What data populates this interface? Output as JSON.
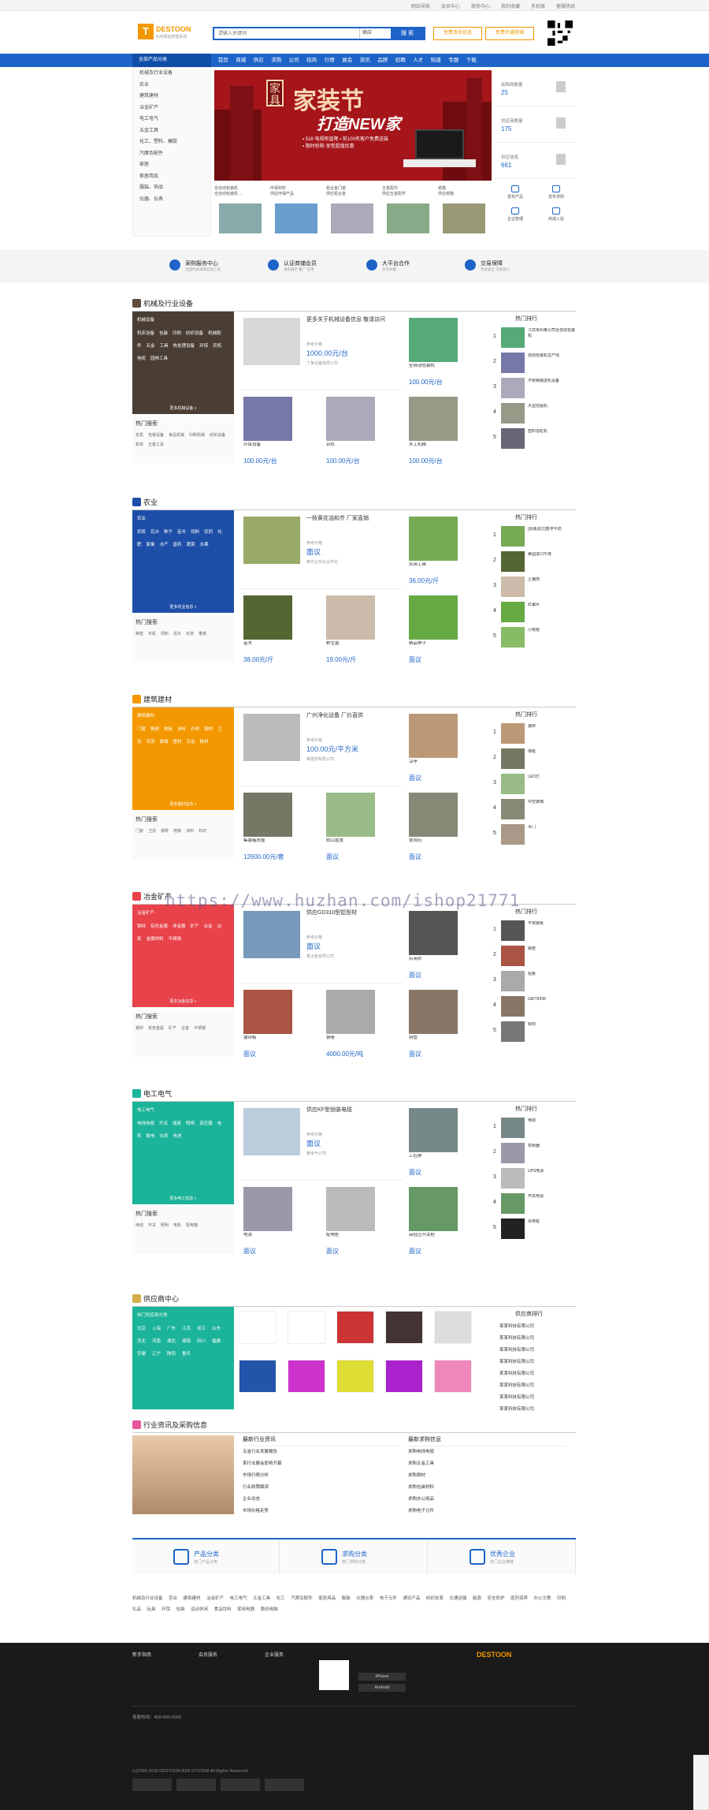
{
  "topbar": {
    "links": [
      "网站导航",
      "会员中心",
      "商务中心",
      "我的收藏",
      "手机版",
      "客服热线"
    ]
  },
  "logo": {
    "name": "DESTOON",
    "sub": "B2B网站管理系统"
  },
  "search": {
    "placeholder": "请输入关键词",
    "select": "供应",
    "button": "搜 索"
  },
  "header": {
    "btn1": "免费发布信息",
    "btn2": "免费开通商铺"
  },
  "nav": {
    "cat": "全部产品分类",
    "items": [
      "首页",
      "商城",
      "供应",
      "求购",
      "公司",
      "招商",
      "行情",
      "展会",
      "资讯",
      "品牌",
      "招聘",
      "人才",
      "知道",
      "专题",
      "下载"
    ]
  },
  "sidecat": [
    "机械及行业设备",
    "农业",
    "建筑建材",
    "冶金矿产",
    "电工电气",
    "五金工具",
    "化工、塑料、橡胶",
    "汽摩及配件",
    "家居",
    "家居用品",
    "服装、饰品",
    "仪器、仪表"
  ],
  "banner": {
    "kanji": "家 具",
    "t1": "家装节",
    "t2": "打造NEW家",
    "sub": "▪ 518 电视柜直降 ▪ 前100名客户免费送装",
    "sub2": "▪ 限时抢购 享受超值优惠"
  },
  "features": [
    {
      "title": "全自动包装机",
      "desc": "全自动包装机 ..."
    },
    {
      "title": "环保材料",
      "desc": "供应环保产品"
    },
    {
      "title": "铝合金门窗",
      "desc": "供应铝合金"
    },
    {
      "title": "五金配件",
      "desc": "供应五金配件"
    },
    {
      "title": "纸箱",
      "desc": "供应纸箱"
    }
  ],
  "stats": [
    {
      "label": "采购商数量",
      "num": "25"
    },
    {
      "label": "供应商数量",
      "num": "175"
    },
    {
      "label": "供应信息",
      "num": "661"
    }
  ],
  "tools": [
    "发布产品",
    "发布求购",
    "企业管理",
    "商城入驻"
  ],
  "services": [
    {
      "t": "采购服务中心",
      "d": "全国优质采购信息汇总"
    },
    {
      "t": "认证商铺会员",
      "d": "发布展示 推广 信用"
    },
    {
      "t": "大平台合作",
      "d": "合作共赢"
    },
    {
      "t": "交易保障",
      "d": "资金安全 交易放心"
    }
  ],
  "sections": [
    {
      "title": "机械及行业设备",
      "color": "#5e4c3e",
      "left": "#4a3e34",
      "ph": "机械设备",
      "links": [
        "机床设备",
        "包装",
        "印刷",
        "纺织设备",
        "机械配件",
        "五金",
        "工具",
        "热处理设备",
        "环保",
        "农机",
        "电机",
        "园林工具"
      ],
      "more": "更多机械设备 »",
      "hot": [
        "农机",
        "包装设备",
        "食品机械",
        "印刷机械",
        "纺织设备",
        "机床",
        "五金工具"
      ],
      "big": {
        "t": "更多关于机械设备信息 敬请访问",
        "lb": "参考价格",
        "pr": "1000.00元/台",
        "cp": "丁某设备有限公司"
      },
      "prods": [
        {
          "t": "全自动包装机",
          "pr": "100.00元/台"
        },
        {
          "t": "环保设备",
          "pr": "100.00元/台"
        },
        {
          "t": "农机",
          "pr": "100.00元/台"
        },
        {
          "t": "木工机械",
          "pr": "100.00元/台"
        },
        {
          "t": "电机",
          "pr": "100.00元/台"
        }
      ],
      "rank": [
        "江苏常州某公司全自动包装机",
        "自动包装机生产线",
        "不锈钢输送机设备",
        "大型挖掘机",
        "塑料造粒机"
      ]
    },
    {
      "title": "农业",
      "color": "#1e4fa8",
      "left": "#1e4fa8",
      "ph": "农业",
      "links": [
        "农机",
        "花卉",
        "种子",
        "苗木",
        "饲料",
        "农药",
        "化肥",
        "家禽",
        "水产",
        "兽药",
        "蔬菜",
        "水果"
      ],
      "more": "更多农业信息 »",
      "hot": [
        "种苗",
        "农机",
        "饲料",
        "花卉",
        "农资",
        "畜禽"
      ],
      "big": {
        "t": "一枝黄花油和芥 厂家直销",
        "lb": "参考价格",
        "pr": "面议",
        "cp": "某农业专业合作社"
      },
      "prods": [
        {
          "t": "农用工具",
          "pr": "36.00元/斤"
        },
        {
          "t": "苗木",
          "pr": "38.00元/斤"
        },
        {
          "t": "野生菌",
          "pr": "19.00元/斤"
        },
        {
          "t": "精品种子",
          "pr": "面议"
        },
        {
          "t": "茶树",
          "pr": "面议"
        }
      ],
      "rank": [
        "[原装进口]香芋牛奶",
        "美国进口牛排",
        "土猪肉",
        "红薯片",
        "小核桃"
      ]
    },
    {
      "title": "建筑建材",
      "color": "#f39800",
      "left": "#f39800",
      "ph": "建筑建材",
      "links": [
        "门窗",
        "陶瓷",
        "地板",
        "涂料",
        "石材",
        "钢材",
        "卫浴",
        "吊顶",
        "玻璃",
        "管材",
        "五金",
        "板材"
      ],
      "more": "更多建材信息 »",
      "hot": [
        "门窗",
        "卫浴",
        "瓷砖",
        "地板",
        "涂料",
        "石材"
      ],
      "big": {
        "t": "广州净化设备 厂价直供",
        "lb": "参考价格",
        "pr": "100.00元/平方米",
        "cp": "某建材有限公司"
      },
      "prods": [
        {
          "t": "凉亭",
          "pr": "面议"
        },
        {
          "t": "集装箱房屋",
          "pr": "12600.00元/套"
        },
        {
          "t": "假山盆景",
          "pr": "面议"
        },
        {
          "t": "景观石",
          "pr": "面议"
        },
        {
          "t": "木屋",
          "pr": "面议"
        }
      ],
      "rank": [
        "瓷砖",
        "墙纸",
        "LED灯",
        "中空玻璃",
        "木门"
      ]
    },
    {
      "title": "冶金矿产",
      "color": "#e8424a",
      "left": "#e8424a",
      "ph": "冶金矿产",
      "links": [
        "钢材",
        "有色金属",
        "非金属",
        "矿产",
        "合金",
        "冶炼",
        "金属材料",
        "不锈钢"
      ],
      "more": "更多冶金信息 »",
      "hot": [
        "钢材",
        "有色金属",
        "矿产",
        "合金",
        "不锈钢"
      ],
      "big": {
        "t": "供应GD310型铝型材",
        "lb": "参考价格",
        "pr": "面议",
        "cp": "某冶金有限公司"
      },
      "prods": [
        {
          "t": "石英砂",
          "pr": "面议"
        },
        {
          "t": "镀锌板",
          "pr": "面议"
        },
        {
          "t": "钢卷",
          "pr": "4000.00元/吨"
        },
        {
          "t": "铜管",
          "pr": "面议"
        },
        {
          "t": "钢材",
          "pr": "面议"
        }
      ],
      "rank": [
        "不锈钢板",
        "钢管",
        "铝板",
        "GB/T9438",
        "铜材"
      ]
    },
    {
      "title": "电工电气",
      "color": "#1bb399",
      "left": "#1bb399",
      "ph": "电工电气",
      "links": [
        "电线电缆",
        "开关",
        "插座",
        "照明",
        "变压器",
        "电机",
        "配电",
        "仪表",
        "电池"
      ],
      "more": "更多电工信息 »",
      "hot": [
        "电线",
        "开关",
        "照明",
        "电机",
        "配电箱"
      ],
      "big": {
        "t": "供应KF型铠装电缆",
        "lb": "参考价格",
        "pr": "面议",
        "cp": "某电气公司"
      },
      "prods": [
        {
          "t": "工控屏",
          "pr": "面议"
        },
        {
          "t": "电源",
          "pr": "面议"
        },
        {
          "t": "配电柜",
          "pr": "面议"
        },
        {
          "t": "高低压开关柜",
          "pr": "面议"
        },
        {
          "t": "箱变",
          "pr": "面议"
        }
      ],
      "rank": [
        "电缆",
        "变频器",
        "UPS电源",
        "开关电源",
        "充电桩"
      ]
    }
  ],
  "supplier": {
    "title": "供应商中心",
    "panel": "热门供应商分类",
    "cities": [
      "北京",
      "上海",
      "广东",
      "江苏",
      "浙江",
      "山东",
      "河北",
      "河南",
      "湖北",
      "湖南",
      "四川",
      "福建",
      "安徽",
      "辽宁",
      "陕西",
      "重庆"
    ],
    "rank_title": "供应商排行",
    "rank": [
      "某某科技有限公司",
      "某某科技有限公司",
      "某某科技有限公司",
      "某某科技有限公司",
      "某某科技有限公司",
      "某某科技有限公司",
      "某某科技有限公司",
      "某某科技有限公司"
    ]
  },
  "news": {
    "title": "行业资讯及采购信息",
    "col1": "最新行业资讯",
    "col2": "最新求购信息",
    "items1": [
      "五金行业发展报告",
      "某行业展会即将开幕",
      "市场行情分析",
      "行业政策解读",
      "企业动态",
      "市场价格走势"
    ],
    "items2": [
      "求购电线电缆",
      "求购五金工具",
      "求购钢材",
      "求购包装材料",
      "求购办公用品",
      "求购电子元件"
    ]
  },
  "tabs3": [
    {
      "t1": "产品分类",
      "t2": "热门产品分类"
    },
    {
      "t1": "求购分类",
      "t2": "热门求购分类"
    },
    {
      "t1": "优秀企业",
      "t2": "热门企业推荐"
    }
  ],
  "links": "机械及行业设备 农业 建筑建材 冶金矿产 电工电气 五金工具 化工 汽摩及配件 家居用品 服装 仪器仪表 电子元件 通讯产品 纺织皮革 交通运输 能源 安全防护 医药保养 办公文教 印刷 礼品 玩具 环保 包装 运动休闲 食品饮料 家用电器 数码电脑",
  "footer": {
    "c1": "新手指南",
    "c2": "会员服务",
    "c3": "企业服务",
    "qr1": "iPhone",
    "qr2": "Android",
    "brand": "DESTOON",
    "copy": "(c)2008-2018 DESTOON B2B SYSTEM All Rights Reserved",
    "contact": "客服热线：400-000-0000"
  }
}
